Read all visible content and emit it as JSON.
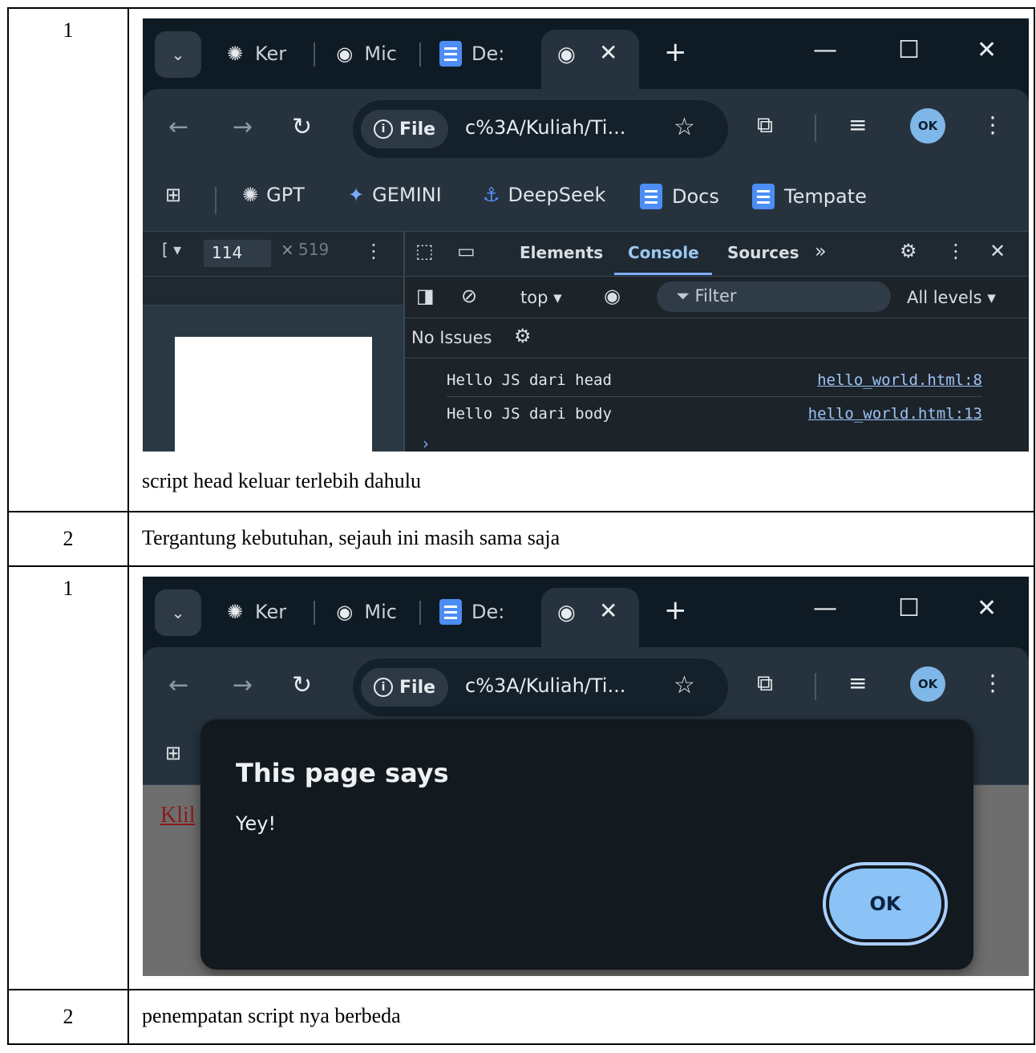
{
  "rows": [
    {
      "num": "1",
      "caption": "script head keluar terlebih dahulu"
    },
    {
      "num": "2",
      "text": "Tergantung kebutuhan, sejauh ini masih sama saja"
    },
    {
      "num": "1"
    },
    {
      "num": "2",
      "text": "penempatan script nya berbeda"
    }
  ],
  "browser": {
    "tabs": [
      "Ker",
      "Mic",
      "De:"
    ],
    "address_chip": "File",
    "url": "c%3A/Kuliah/Ti...",
    "avatar": "OK",
    "bookmarks": [
      "GPT",
      "GEMINI",
      "DeepSeek",
      "Docs",
      "Tempate"
    ]
  },
  "devtools": {
    "dim_width": "114",
    "dim_height": "519",
    "tabs": [
      "Elements",
      "Console",
      "Sources"
    ],
    "active_tab": "Console",
    "context": "top",
    "filter_placeholder": "Filter",
    "levels": "All levels",
    "issues": "No Issues",
    "logs": [
      {
        "message": "Hello JS dari head",
        "source": "hello_world.html:8"
      },
      {
        "message": "Hello JS dari body",
        "source": "hello_world.html:13"
      }
    ]
  },
  "alert": {
    "title": "This page says",
    "message": "Yey!",
    "ok": "OK",
    "page_link_text": "Klil"
  },
  "colors": {
    "accent": "#7cacf8",
    "ok_button": "#8bc3f6",
    "dialog_bg": "#12191f"
  }
}
